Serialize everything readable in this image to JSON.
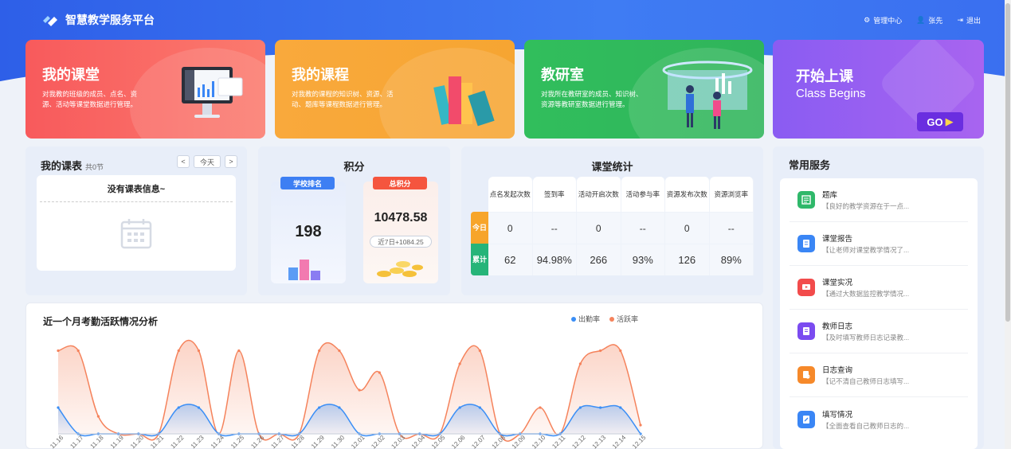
{
  "app": {
    "title": "智慧教学服务平台"
  },
  "topnav": {
    "admin": "管理中心",
    "user": "张先",
    "logout": "退出"
  },
  "cards": {
    "classroom": {
      "title": "我的课堂",
      "desc": "对我教的班级的成员、点名、资源、活动等课堂数据进行管理。"
    },
    "courses": {
      "title": "我的课程",
      "desc": "对我教的课程的知识树、资源、活动、题库等课程数据进行管理。"
    },
    "research": {
      "title": "教研室",
      "desc": "对我所在教研室的成员、知识树、资源等教研室数据进行管理。"
    },
    "start": {
      "title": "开始上课",
      "subtitle": "Class Begins",
      "go": "GO"
    }
  },
  "schedule": {
    "title": "我的课表",
    "count": "共0节",
    "today": "今天",
    "prev": "<",
    "next": ">",
    "empty": "没有课表信息~"
  },
  "points": {
    "title": "积分",
    "rank_label": "学校排名",
    "rank_value": "198",
    "total_label": "总积分",
    "total_value": "10478.58",
    "recent": "近7日+1084.25"
  },
  "stats": {
    "title": "课堂统计",
    "headers": [
      "点名发起次数",
      "签到率",
      "活动开启次数",
      "活动参与率",
      "资源发布次数",
      "资源浏览率"
    ],
    "today_label": "今日",
    "total_label": "累计",
    "today": [
      "0",
      "--",
      "0",
      "--",
      "0",
      "--"
    ],
    "total": [
      "62",
      "94.98%",
      "266",
      "93%",
      "126",
      "89%"
    ]
  },
  "services": {
    "title": "常用服务",
    "items": [
      {
        "name": "题库",
        "desc": "【良好的教学资源在于一点...",
        "color": "#2fb86a"
      },
      {
        "name": "课堂报告",
        "desc": "【让老师对课堂教学情况了...",
        "color": "#3a86f5"
      },
      {
        "name": "课堂实况",
        "desc": "【通过大数据监控教学情况...",
        "color": "#f24b4b"
      },
      {
        "name": "教师日志",
        "desc": "【及时填写教师日志记录教...",
        "color": "#7b4bf0"
      },
      {
        "name": "日志查询",
        "desc": "【记不清自己教师日志填写...",
        "color": "#f6892a"
      },
      {
        "name": "填写情况",
        "desc": "【全面查看自己教师日志的...",
        "color": "#3a86f5"
      }
    ]
  },
  "chart_data": {
    "type": "area",
    "title": "近一个月考勤活跃情况分析",
    "x": [
      "11.16",
      "11.17",
      "11.18",
      "11.19",
      "11.20",
      "11.21",
      "11.22",
      "11.23",
      "11.24",
      "11.25",
      "11.26",
      "11.27",
      "11.28",
      "11.29",
      "11.30",
      "12.01",
      "12.02",
      "12.03",
      "12.04",
      "12.05",
      "12.06",
      "12.07",
      "12.08",
      "12.09",
      "12.10",
      "12.11",
      "12.12",
      "12.13",
      "12.14",
      "12.15"
    ],
    "series": [
      {
        "name": "出勤率",
        "color": "#3a8ef6",
        "values": [
          0.3,
          0,
          0,
          0,
          0,
          0,
          0.3,
          0.3,
          0,
          0,
          0,
          0,
          0,
          0.3,
          0.3,
          0,
          0,
          0,
          0,
          0,
          0.3,
          0.3,
          0,
          0,
          0,
          0,
          0.3,
          0.3,
          0.3,
          0
        ]
      },
      {
        "name": "活跃率",
        "color": "#f5835c",
        "values": [
          0.95,
          0.95,
          0.2,
          0,
          0,
          0,
          0.95,
          0.95,
          0,
          0.95,
          0,
          0,
          0,
          0.95,
          0.95,
          0.5,
          0.7,
          0,
          0,
          0,
          0.8,
          0.95,
          0,
          0,
          0.3,
          0,
          0.8,
          0.95,
          0.95,
          0.1
        ]
      }
    ],
    "ylim": [
      0,
      1
    ],
    "legend": "top-right",
    "grid": false
  }
}
